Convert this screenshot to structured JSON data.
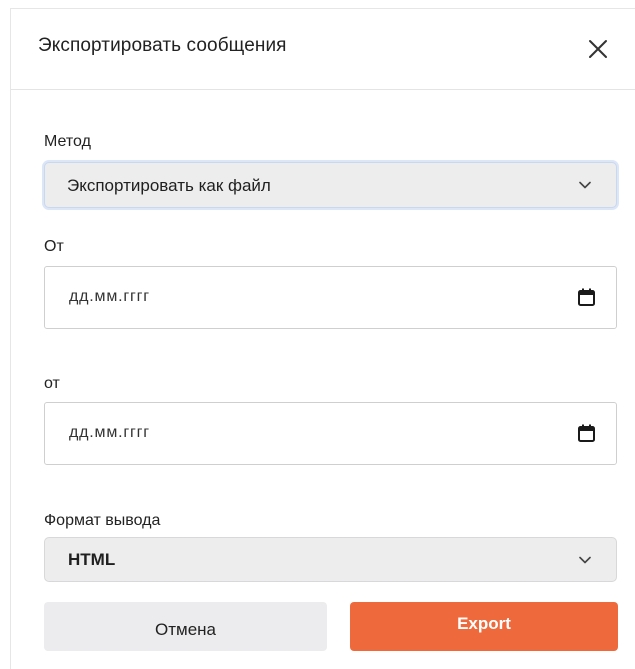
{
  "dialog": {
    "title": "Экспортировать сообщения",
    "close_icon": "close-icon"
  },
  "method": {
    "label": "Метод",
    "value": "Экспортировать как файл"
  },
  "from_date": {
    "label": "От",
    "placeholder": "дд.мм.гггг"
  },
  "to_date": {
    "label": "от",
    "placeholder": "дд.мм.гггг"
  },
  "output_format": {
    "label": "Формат вывода",
    "value": "HTML"
  },
  "buttons": {
    "cancel": "Отмена",
    "export": "Export"
  },
  "colors": {
    "accent": "#ee6a3c",
    "select_bg": "#ededee",
    "focus_ring": "#dbe6f7"
  }
}
